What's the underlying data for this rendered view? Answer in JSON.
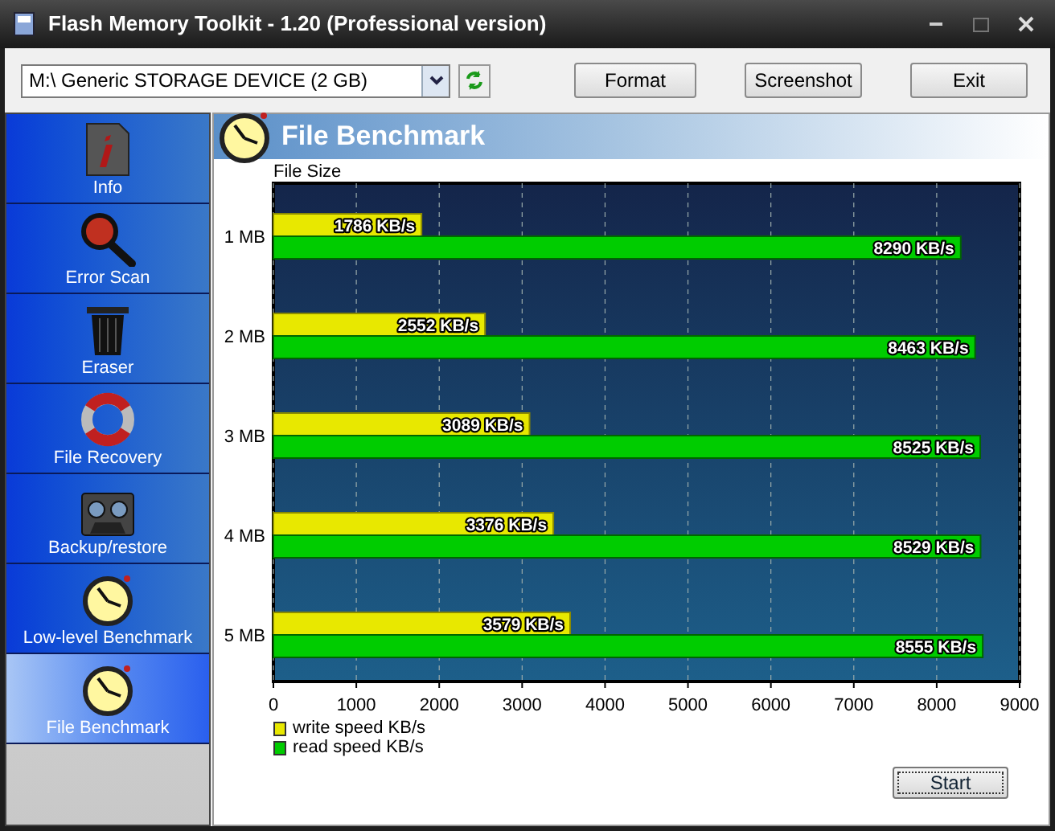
{
  "window": {
    "title": "Flash Memory Toolkit - 1.20 (Professional version)"
  },
  "toolbar": {
    "device": {
      "value": "M:\\ Generic STORAGE DEVICE (2 GB)"
    },
    "buttons": [
      "Format",
      "Screenshot",
      "Exit"
    ]
  },
  "sidebar": {
    "items": [
      {
        "label": "Info",
        "kind": "info",
        "selected": false
      },
      {
        "label": "Error Scan",
        "kind": "scan",
        "selected": false
      },
      {
        "label": "Eraser",
        "kind": "bin",
        "selected": false
      },
      {
        "label": "File Recovery",
        "kind": "ring",
        "selected": false
      },
      {
        "label": "Backup/restore",
        "kind": "tape",
        "selected": false
      },
      {
        "label": "Low-level Benchmark",
        "kind": "clock",
        "selected": false
      },
      {
        "label": "File Benchmark",
        "kind": "clock",
        "selected": true
      }
    ]
  },
  "panel": {
    "title": "File Benchmark",
    "chart_data": {
      "type": "bar",
      "orientation": "horizontal",
      "grid": true,
      "ylabel": "File Size",
      "categories": [
        "1 MB",
        "2 MB",
        "3 MB",
        "4 MB",
        "5 MB"
      ],
      "xlim": [
        0,
        9000
      ],
      "xticks": [
        0,
        1000,
        2000,
        3000,
        4000,
        5000,
        6000,
        7000,
        8000,
        9000
      ],
      "series": [
        {
          "name": "write speed KB/s",
          "color": "#e8e800",
          "values": [
            1786,
            2552,
            3089,
            3376,
            3579
          ],
          "value_labels": [
            "1786 KB/s",
            "2552 KB/s",
            "3089 KB/s",
            "3376 KB/s",
            "3579 KB/s"
          ]
        },
        {
          "name": "read speed KB/s",
          "color": "#00cc00",
          "values": [
            8290,
            8463,
            8525,
            8529,
            8555
          ],
          "value_labels": [
            "8290 KB/s",
            "8463 KB/s",
            "8525 KB/s",
            "8529 KB/s",
            "8555 KB/s"
          ]
        }
      ]
    },
    "start_button": "Start"
  }
}
